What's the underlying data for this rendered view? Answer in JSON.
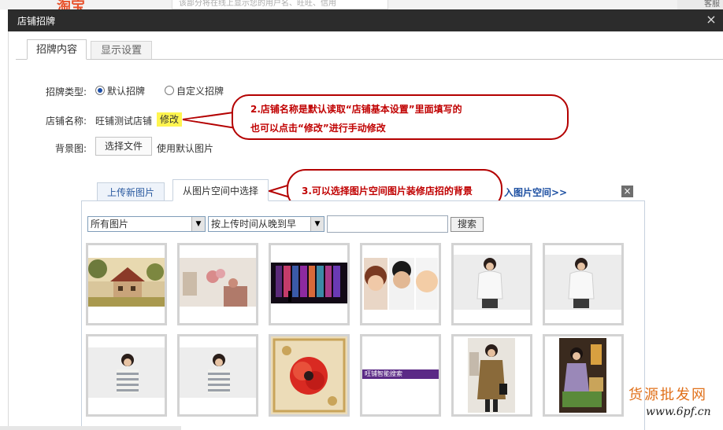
{
  "background_page": {
    "logo": "淘宝",
    "search_placeholder": "该部分将在线上显示您的用户名、旺旺、信用",
    "right_text": "客服"
  },
  "dialog": {
    "title": "店铺招牌",
    "close_symbol": "×",
    "tabs": [
      {
        "label": "招牌内容",
        "active": true
      },
      {
        "label": "显示设置",
        "active": false
      }
    ]
  },
  "form": {
    "type_label": "招牌类型:",
    "type_options": [
      {
        "label": "默认招牌",
        "selected": true
      },
      {
        "label": "自定义招牌",
        "selected": false
      }
    ],
    "name_label": "店铺名称:",
    "name_value": "旺铺测试店铺",
    "edit_label": "修改",
    "bg_label": "背景图:",
    "choose_file_label": "选择文件",
    "bg_hint": "使用默认图片"
  },
  "callouts": {
    "c2_line1": "2.店铺名称是默认读取“店铺基本设置”里面填写的",
    "c2_line2": "也可以点击“修改”进行手动修改",
    "c3": "3.可以选择图片空间图片装修店招的背景"
  },
  "picker": {
    "tabs": [
      {
        "label": "上传新图片",
        "active": false
      },
      {
        "label": "从图片空间中选择",
        "active": true
      }
    ],
    "enter_space_link": "入图片空间>>",
    "close_symbol": "×",
    "filter_select": "所有图片",
    "sort_select": "按上传时间从晚到早",
    "search_value": "",
    "search_button": "搜索",
    "thumbnails": [
      {
        "icon": "house-photo"
      },
      {
        "icon": "flowers-photo"
      },
      {
        "icon": "night-lights-photo"
      },
      {
        "icon": "faces-photo"
      },
      {
        "icon": "model-white-sweater-photo"
      },
      {
        "icon": "model-white-sweater-photo"
      },
      {
        "icon": "model-striped-sweater-photo"
      },
      {
        "icon": "model-striped-sweater-photo"
      },
      {
        "icon": "poppy-art-photo"
      },
      {
        "icon": "banner-photo",
        "caption": "旺铺智能搜索"
      },
      {
        "icon": "model-coat-photo"
      },
      {
        "icon": "model-dress-photo"
      }
    ]
  },
  "watermark": {
    "line1": "货源批发网",
    "line2": "www.6pf.cn"
  },
  "colors": {
    "titlebar": "#2c2c2c",
    "callout_border": "#b40000",
    "callout_text": "#c00000",
    "edit_highlight": "#fff54f",
    "link": "#1e50a2"
  }
}
